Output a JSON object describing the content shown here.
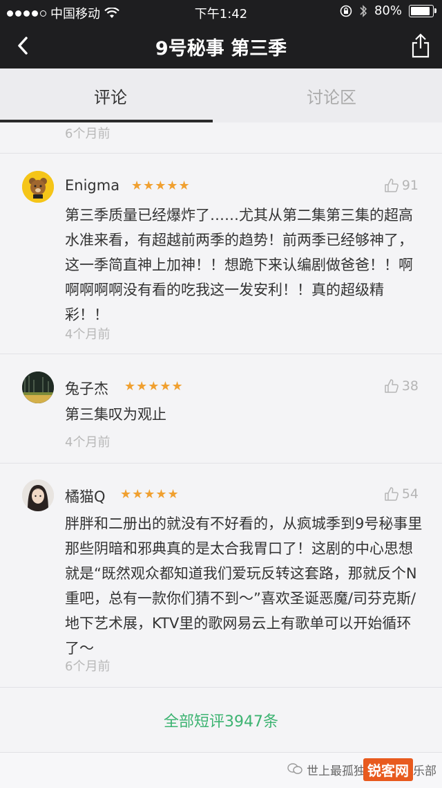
{
  "status": {
    "carrier": "中国移动",
    "time": "下午1:42",
    "battery": "80%"
  },
  "nav": {
    "title": "9号秘事 第三季"
  },
  "tabs": [
    {
      "label": "评论"
    },
    {
      "label": "讨论区"
    }
  ],
  "top_time": "6个月前",
  "reviews": [
    {
      "user": "Enigma",
      "stars": "★★★★★",
      "likes": "91",
      "text": "第三季质量已经爆炸了……尤其从第二集第三集的超高水准来看，有超越前两季的趋势！前两季已经够神了，这一季简直神上加神！！想跪下来认编剧做爸爸！！啊啊啊啊啊没有看的吃我这一发安利！！真的超级精彩！！",
      "time": "4个月前"
    },
    {
      "user": "兔子杰",
      "stars": "★★★★★",
      "likes": "38",
      "text": "第三集叹为观止",
      "time": "4个月前"
    },
    {
      "user": "橘猫Q",
      "stars": "★★★★★",
      "likes": "54",
      "text": "胖胖和二册出的就没有不好看的，从疯城季到9号秘事里那些阴暗和邪典真的是太合我胃口了！这剧的中心思想就是“既然观众都知道我们爱玩反转这套路，那就反个N重吧，总有一款你们猜不到～”喜欢圣诞恶魔/司芬克斯/地下艺术展，KTV里的歌网易云上有歌单可以开始循环了～",
      "time": "6个月前"
    }
  ],
  "all_reviews_link": "全部短评3947条",
  "watermark": {
    "text": "世上最孤独",
    "logo": "锐客网",
    "suffix": "乐部"
  },
  "colors": {
    "accent_green": "#3cb371",
    "star": "#f0a030",
    "nav_bg": "#1e1e20"
  }
}
